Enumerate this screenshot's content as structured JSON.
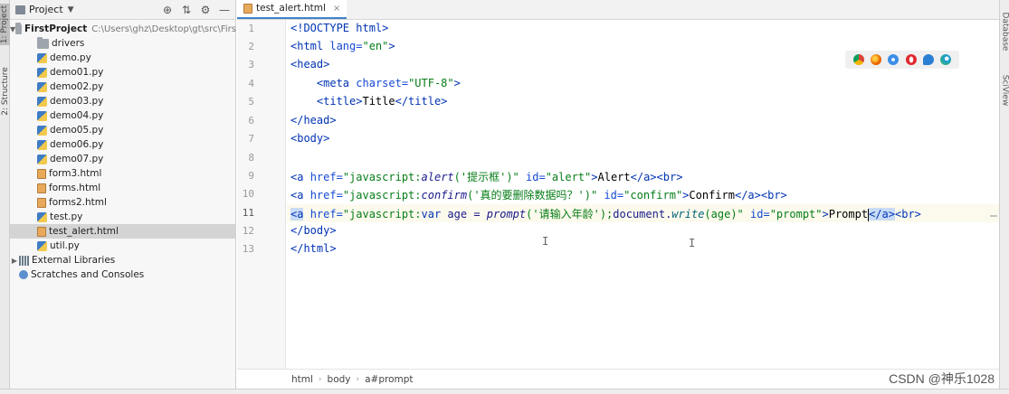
{
  "left_strip": {
    "tabs": [
      "1: Project",
      "2: Structure"
    ]
  },
  "right_strip": {
    "tabs": [
      "Database",
      "SciView"
    ]
  },
  "project_panel": {
    "title": "Project",
    "dropdown_icon": "chevron-down-icon",
    "tools": [
      "locate-icon",
      "collapse-icon",
      "gear-icon",
      "minimize-icon"
    ],
    "root": {
      "name": "FirstProject",
      "path": "C:\\Users\\ghz\\Desktop\\gt\\src\\Firs"
    },
    "items": [
      {
        "label": "drivers",
        "type": "folder"
      },
      {
        "label": "demo.py",
        "type": "py"
      },
      {
        "label": "demo01.py",
        "type": "py"
      },
      {
        "label": "demo02.py",
        "type": "py"
      },
      {
        "label": "demo03.py",
        "type": "py"
      },
      {
        "label": "demo04.py",
        "type": "py"
      },
      {
        "label": "demo05.py",
        "type": "py"
      },
      {
        "label": "demo06.py",
        "type": "py"
      },
      {
        "label": "demo07.py",
        "type": "py"
      },
      {
        "label": "form3.html",
        "type": "html"
      },
      {
        "label": "forms.html",
        "type": "html"
      },
      {
        "label": "forms2.html",
        "type": "html"
      },
      {
        "label": "test.py",
        "type": "py"
      },
      {
        "label": "test_alert.html",
        "type": "html",
        "selected": true
      },
      {
        "label": "util.py",
        "type": "py"
      }
    ],
    "external_libraries": "External Libraries",
    "scratches": "Scratches and Consoles"
  },
  "editor": {
    "tab": {
      "label": "test_alert.html",
      "icon": "html-file-icon"
    },
    "current_line": 11,
    "line_numbers": [
      "1",
      "2",
      "3",
      "4",
      "5",
      "6",
      "7",
      "8",
      "9",
      "10",
      "11",
      "12",
      "13"
    ],
    "lines": {
      "l1": "<!DOCTYPE html>",
      "l2_tag": "<html ",
      "l2_attr": "lang=",
      "l2_val": "\"en\"",
      "l2_end": ">",
      "l3": "<head>",
      "l4_ind": "    ",
      "l4_tag": "<meta ",
      "l4_attr": "charset=",
      "l4_val": "\"UTF-8\"",
      "l4_end": ">",
      "l5_ind": "    ",
      "l5_tag": "<title>",
      "l5_text": "Title",
      "l5_end": "</title>",
      "l6": "</head>",
      "l7": "<body>",
      "l9_tag": "<a ",
      "l9_href": "href=",
      "l9_v1": "\"javascript:",
      "l9_fn": "alert",
      "l9_v2": "('提示框')\"",
      "l9_sp": " ",
      "l9_id": "id=",
      "l9_idv": "\"alert\"",
      "l9_gt": ">",
      "l9_text": "Alert",
      "l9_close": "</a><br>",
      "l10_tag": "<a ",
      "l10_href": "href=",
      "l10_v1": "\"javascript:",
      "l10_fn": "confirm",
      "l10_v2": "('真的要删除数据吗？')\"",
      "l10_sp": " ",
      "l10_id": "id=",
      "l10_idv": "\"confirm\"",
      "l10_gt": ">",
      "l10_text": "Confirm",
      "l10_close": "</a><br>",
      "l11_tag": "<a",
      "l11_sp0": " ",
      "l11_href": "href=",
      "l11_v1": "\"javascript:",
      "l11_var": "var",
      "l11_mid": " age = ",
      "l11_fn": "prompt",
      "l11_v2": "('请输入年龄');",
      "l11_doc": "document.",
      "l11_write": "write",
      "l11_v3": "(age)\"",
      "l11_sp": " ",
      "l11_id": "id=",
      "l11_idv": "\"prompt\"",
      "l11_gt": ">",
      "l11_text": "Prompt",
      "l11_close1": "</a>",
      "l11_close2": "<br>",
      "l12": "</body>",
      "l13": "</html>"
    },
    "browser_icons": [
      "chrome-icon",
      "firefox-icon",
      "safari-icon",
      "opera-icon",
      "edge-legacy-icon",
      "edge-icon"
    ],
    "breadcrumb": [
      "html",
      "body",
      "a#prompt"
    ]
  },
  "watermark": "CSDN @神乐1028",
  "colors": {
    "tag": "#0033b3",
    "attr": "#174ad4",
    "string": "#067d17",
    "selection": "#4083c9"
  }
}
